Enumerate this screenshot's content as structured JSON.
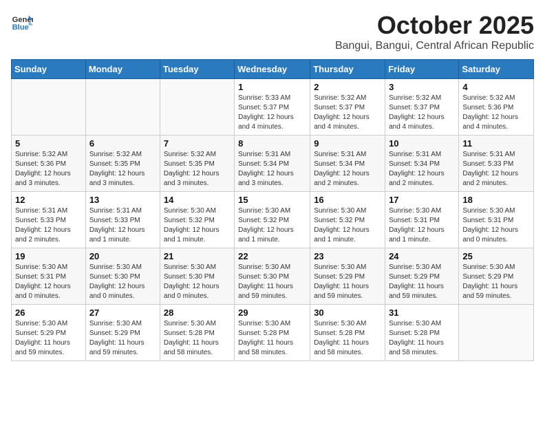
{
  "header": {
    "logo": {
      "general": "General",
      "blue": "Blue"
    },
    "title": "October 2025",
    "subtitle": "Bangui, Bangui, Central African Republic"
  },
  "weekdays": [
    "Sunday",
    "Monday",
    "Tuesday",
    "Wednesday",
    "Thursday",
    "Friday",
    "Saturday"
  ],
  "weeks": [
    [
      {
        "day": "",
        "info": ""
      },
      {
        "day": "",
        "info": ""
      },
      {
        "day": "",
        "info": ""
      },
      {
        "day": "1",
        "info": "Sunrise: 5:33 AM\nSunset: 5:37 PM\nDaylight: 12 hours\nand 4 minutes."
      },
      {
        "day": "2",
        "info": "Sunrise: 5:32 AM\nSunset: 5:37 PM\nDaylight: 12 hours\nand 4 minutes."
      },
      {
        "day": "3",
        "info": "Sunrise: 5:32 AM\nSunset: 5:37 PM\nDaylight: 12 hours\nand 4 minutes."
      },
      {
        "day": "4",
        "info": "Sunrise: 5:32 AM\nSunset: 5:36 PM\nDaylight: 12 hours\nand 4 minutes."
      }
    ],
    [
      {
        "day": "5",
        "info": "Sunrise: 5:32 AM\nSunset: 5:36 PM\nDaylight: 12 hours\nand 3 minutes."
      },
      {
        "day": "6",
        "info": "Sunrise: 5:32 AM\nSunset: 5:35 PM\nDaylight: 12 hours\nand 3 minutes."
      },
      {
        "day": "7",
        "info": "Sunrise: 5:32 AM\nSunset: 5:35 PM\nDaylight: 12 hours\nand 3 minutes."
      },
      {
        "day": "8",
        "info": "Sunrise: 5:31 AM\nSunset: 5:34 PM\nDaylight: 12 hours\nand 3 minutes."
      },
      {
        "day": "9",
        "info": "Sunrise: 5:31 AM\nSunset: 5:34 PM\nDaylight: 12 hours\nand 2 minutes."
      },
      {
        "day": "10",
        "info": "Sunrise: 5:31 AM\nSunset: 5:34 PM\nDaylight: 12 hours\nand 2 minutes."
      },
      {
        "day": "11",
        "info": "Sunrise: 5:31 AM\nSunset: 5:33 PM\nDaylight: 12 hours\nand 2 minutes."
      }
    ],
    [
      {
        "day": "12",
        "info": "Sunrise: 5:31 AM\nSunset: 5:33 PM\nDaylight: 12 hours\nand 2 minutes."
      },
      {
        "day": "13",
        "info": "Sunrise: 5:31 AM\nSunset: 5:33 PM\nDaylight: 12 hours\nand 1 minute."
      },
      {
        "day": "14",
        "info": "Sunrise: 5:30 AM\nSunset: 5:32 PM\nDaylight: 12 hours\nand 1 minute."
      },
      {
        "day": "15",
        "info": "Sunrise: 5:30 AM\nSunset: 5:32 PM\nDaylight: 12 hours\nand 1 minute."
      },
      {
        "day": "16",
        "info": "Sunrise: 5:30 AM\nSunset: 5:32 PM\nDaylight: 12 hours\nand 1 minute."
      },
      {
        "day": "17",
        "info": "Sunrise: 5:30 AM\nSunset: 5:31 PM\nDaylight: 12 hours\nand 1 minute."
      },
      {
        "day": "18",
        "info": "Sunrise: 5:30 AM\nSunset: 5:31 PM\nDaylight: 12 hours\nand 0 minutes."
      }
    ],
    [
      {
        "day": "19",
        "info": "Sunrise: 5:30 AM\nSunset: 5:31 PM\nDaylight: 12 hours\nand 0 minutes."
      },
      {
        "day": "20",
        "info": "Sunrise: 5:30 AM\nSunset: 5:30 PM\nDaylight: 12 hours\nand 0 minutes."
      },
      {
        "day": "21",
        "info": "Sunrise: 5:30 AM\nSunset: 5:30 PM\nDaylight: 12 hours\nand 0 minutes."
      },
      {
        "day": "22",
        "info": "Sunrise: 5:30 AM\nSunset: 5:30 PM\nDaylight: 11 hours\nand 59 minutes."
      },
      {
        "day": "23",
        "info": "Sunrise: 5:30 AM\nSunset: 5:29 PM\nDaylight: 11 hours\nand 59 minutes."
      },
      {
        "day": "24",
        "info": "Sunrise: 5:30 AM\nSunset: 5:29 PM\nDaylight: 11 hours\nand 59 minutes."
      },
      {
        "day": "25",
        "info": "Sunrise: 5:30 AM\nSunset: 5:29 PM\nDaylight: 11 hours\nand 59 minutes."
      }
    ],
    [
      {
        "day": "26",
        "info": "Sunrise: 5:30 AM\nSunset: 5:29 PM\nDaylight: 11 hours\nand 59 minutes."
      },
      {
        "day": "27",
        "info": "Sunrise: 5:30 AM\nSunset: 5:29 PM\nDaylight: 11 hours\nand 59 minutes."
      },
      {
        "day": "28",
        "info": "Sunrise: 5:30 AM\nSunset: 5:28 PM\nDaylight: 11 hours\nand 58 minutes."
      },
      {
        "day": "29",
        "info": "Sunrise: 5:30 AM\nSunset: 5:28 PM\nDaylight: 11 hours\nand 58 minutes."
      },
      {
        "day": "30",
        "info": "Sunrise: 5:30 AM\nSunset: 5:28 PM\nDaylight: 11 hours\nand 58 minutes."
      },
      {
        "day": "31",
        "info": "Sunrise: 5:30 AM\nSunset: 5:28 PM\nDaylight: 11 hours\nand 58 minutes."
      },
      {
        "day": "",
        "info": ""
      }
    ]
  ]
}
